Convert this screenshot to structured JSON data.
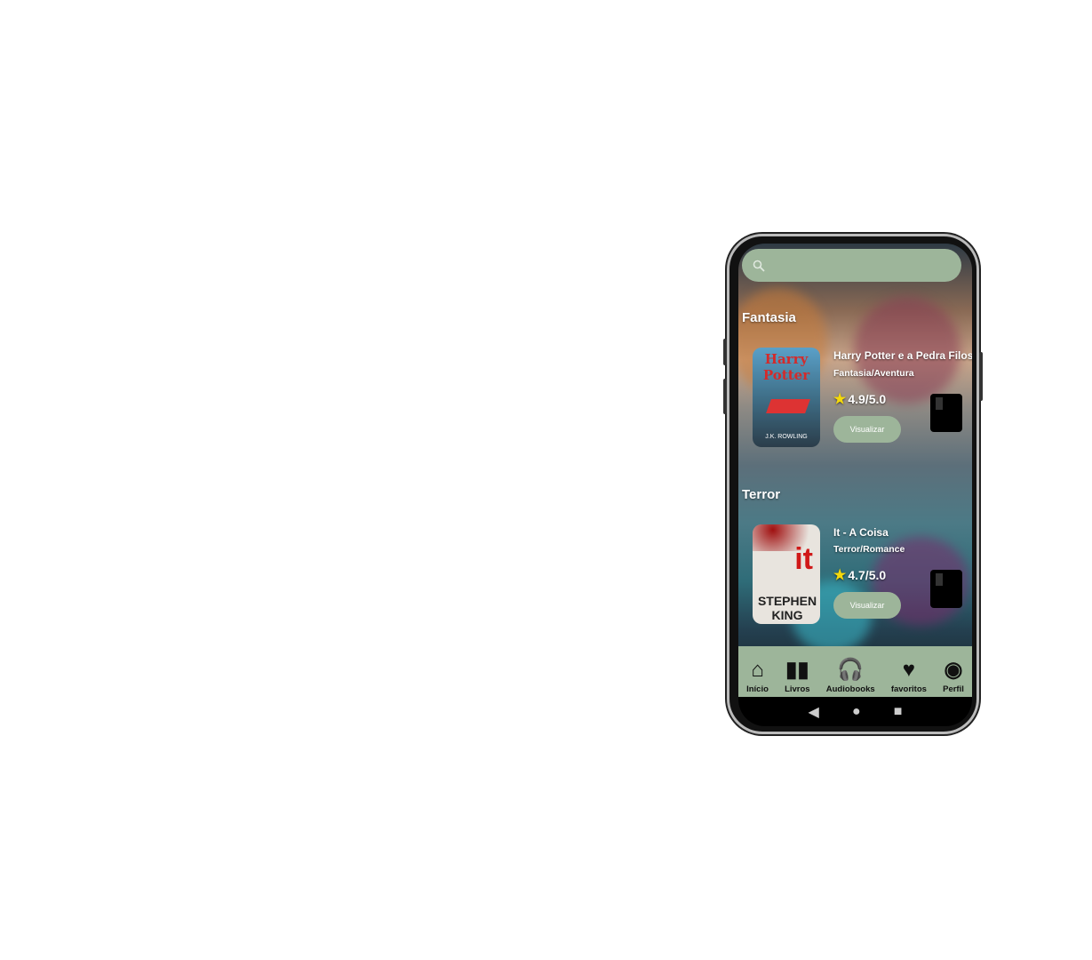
{
  "search": {
    "placeholder": "",
    "icon": "search-icon"
  },
  "sections": [
    {
      "category": "Fantasia",
      "book": {
        "title": "Harry Potter e a Pedra Filos",
        "genre": "Fantasia/Aventura",
        "rating": "4.9/5.0",
        "button": "Visualizar",
        "cover_text": "Harry Potter",
        "cover_author": "J.K. ROWLING"
      }
    },
    {
      "category": "Terror",
      "book": {
        "title": "It - A Coisa",
        "genre": "Terror/Romance",
        "rating": "4.7/5.0",
        "button": "Visualizar",
        "cover_text": "it",
        "cover_author": "STEPHEN KING"
      }
    }
  ],
  "nav": [
    {
      "label": "Início",
      "icon": "home-icon"
    },
    {
      "label": "Livros",
      "icon": "book-icon"
    },
    {
      "label": "Audiobooks",
      "icon": "headphones-icon"
    },
    {
      "label": "favoritos",
      "icon": "heart-icon"
    },
    {
      "label": "Perfil",
      "icon": "profile-icon"
    }
  ],
  "colors": {
    "accent": "#9db59a",
    "star": "#f5d90a"
  }
}
